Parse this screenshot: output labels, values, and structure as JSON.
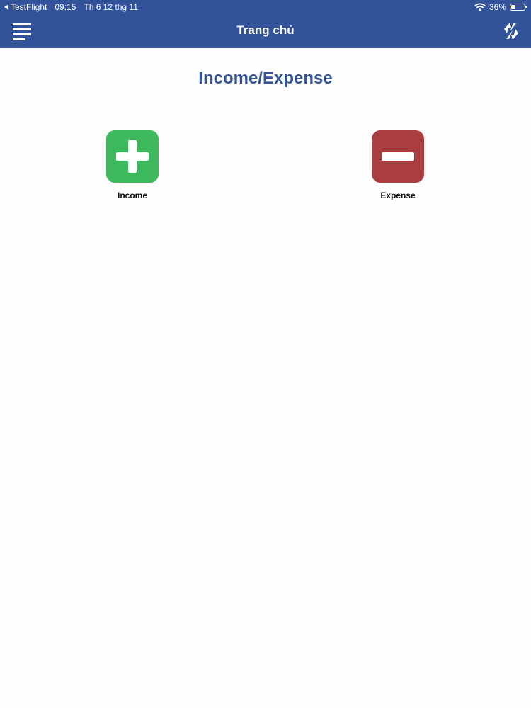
{
  "status_bar": {
    "back_app": "TestFlight",
    "time": "09:15",
    "date": "Th 6 12 thg 11",
    "battery_text": "36%",
    "battery_level": 0.36,
    "wifi_icon": "wifi-icon"
  },
  "navbar": {
    "title": "Trang chủ",
    "menu_icon": "menu-icon",
    "sync_icon": "sync-icon",
    "background": "#325399"
  },
  "main": {
    "heading": "Income/Expense",
    "heading_color": "#365394",
    "actions": [
      {
        "label": "Income",
        "icon": "plus-icon",
        "color": "#3db85c"
      },
      {
        "label": "Expense",
        "icon": "minus-icon",
        "color": "#a93d3f"
      }
    ]
  }
}
